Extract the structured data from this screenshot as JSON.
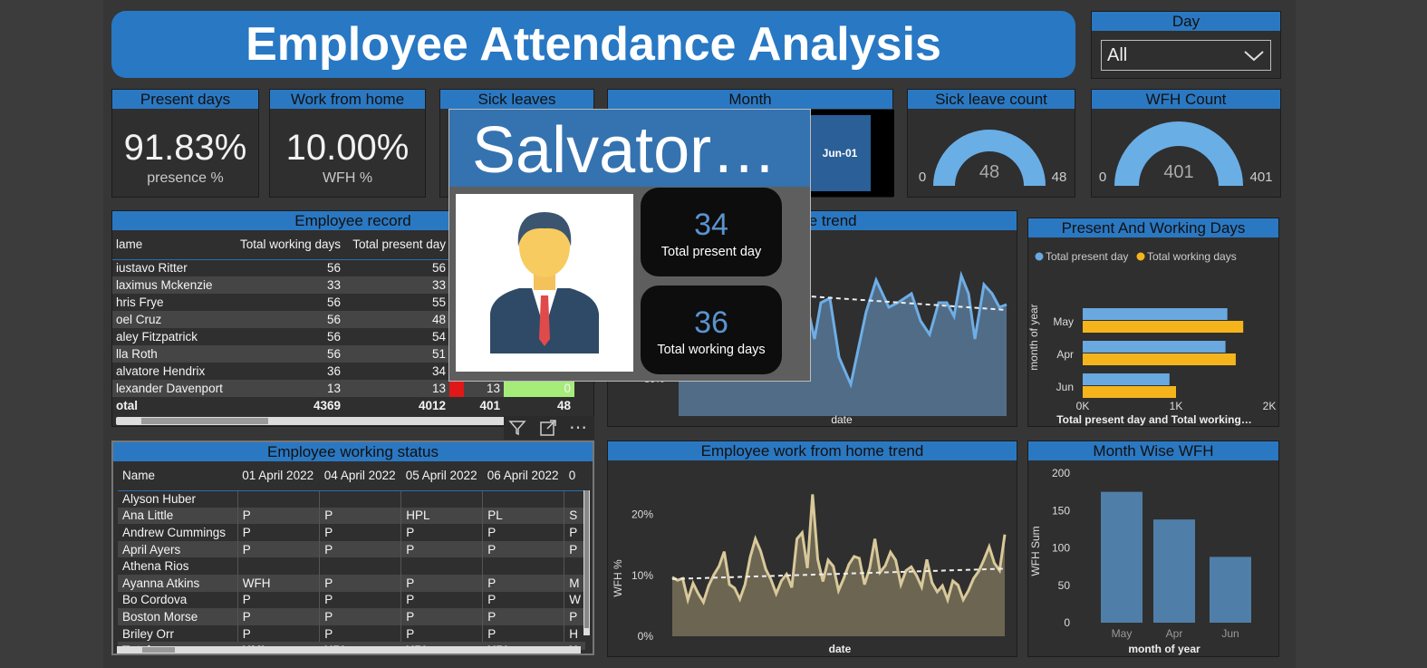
{
  "title": "Employee Attendance Analysis",
  "day_slicer": {
    "header": "Day",
    "value": "All"
  },
  "kpis": {
    "present": {
      "header": "Present days",
      "value": "91.83%",
      "label": "presence %"
    },
    "wfh": {
      "header": "Work from home",
      "value": "10.00%",
      "label": "WFH %"
    },
    "sick": {
      "header": "Sick leaves"
    },
    "month": {
      "header": "Month",
      "item": "Jun-01"
    }
  },
  "gauges": {
    "sick_count": {
      "header": "Sick leave count",
      "value": "48",
      "min": "0",
      "max": "48",
      "fill": 1.0
    },
    "wfh_count": {
      "header": "WFH Count",
      "value": "401",
      "min": "0",
      "max": "401",
      "fill": 1.0
    }
  },
  "employee_record": {
    "header": "Employee record",
    "columns": [
      "lame",
      "Total working days",
      "Total present day"
    ],
    "rows": [
      [
        "iustavo Ritter",
        "56",
        "56"
      ],
      [
        "laximus Mckenzie",
        "33",
        "33"
      ],
      [
        "hris Frye",
        "56",
        "55"
      ],
      [
        "oel Cruz",
        "56",
        "48"
      ],
      [
        "aley Fitzpatrick",
        "56",
        "54"
      ],
      [
        "lla Roth",
        "56",
        "51"
      ],
      [
        "alvatore Hendrix",
        "36",
        "34"
      ],
      [
        "lexander Davenport",
        "13",
        "13"
      ]
    ],
    "extra_row": {
      "c4": "13",
      "c5": "0"
    },
    "total": [
      "otal",
      "4369",
      "4012",
      "401",
      "48"
    ]
  },
  "tooltip": {
    "name": "Salvator…",
    "present_value": "34",
    "present_label": "Total present day",
    "working_value": "36",
    "working_label": "Total working days"
  },
  "presence_trend": {
    "header": "Employee presence trend",
    "header_visible": "esence trend",
    "x_label": "date",
    "y_tick": "80%"
  },
  "present_working": {
    "header": "Present And Working Days",
    "legend": [
      "Total present day",
      "Total working days"
    ],
    "colors": {
      "present": "#6aa8e0",
      "working": "#f5b41c"
    },
    "chart_data": {
      "type": "bar",
      "orientation": "horizontal",
      "categories": [
        "May",
        "Apr",
        "Jun"
      ],
      "series": [
        {
          "name": "Total present day",
          "values": [
            1550,
            1530,
            930
          ]
        },
        {
          "name": "Total working days",
          "values": [
            1720,
            1640,
            1000
          ]
        }
      ],
      "xlim": [
        0,
        2000
      ],
      "x_ticks": [
        "0K",
        "1K",
        "2K"
      ],
      "xlabel": "Total present day and Total working…",
      "ylabel": "month of year"
    }
  },
  "working_status": {
    "header": "Employee working status",
    "columns": [
      "Name",
      "01 April 2022",
      "04 April 2022",
      "05 April 2022",
      "06 April 2022",
      "0"
    ],
    "rows": [
      [
        "Alyson Huber",
        "",
        "",
        "",
        "",
        ""
      ],
      [
        "Ana Little",
        "P",
        "P",
        "HPL",
        "PL",
        "S"
      ],
      [
        "Andrew Cummings",
        "P",
        "P",
        "P",
        "P",
        "P"
      ],
      [
        "April Ayers",
        "P",
        "P",
        "P",
        "P",
        "P"
      ],
      [
        "Athena Rios",
        "",
        "",
        "",
        "",
        ""
      ],
      [
        "Ayanna Atkins",
        "WFH",
        "P",
        "P",
        "P",
        "M"
      ],
      [
        "Bo Cordova",
        "P",
        "P",
        "P",
        "P",
        "W"
      ],
      [
        "Boston Morse",
        "P",
        "P",
        "P",
        "P",
        "P"
      ],
      [
        "Briley Orr",
        "P",
        "P",
        "P",
        "P",
        "H"
      ]
    ],
    "total": [
      "Total",
      "HML",
      "HPL",
      "HPL",
      "HPL",
      "H"
    ]
  },
  "wfh_trend": {
    "header": "Employee work from home trend",
    "x_label": "date",
    "y_label": "WFH %",
    "y_ticks": [
      "20%",
      "10%",
      "0%"
    ],
    "chart_data": {
      "type": "area",
      "y_axis": "WFH %",
      "ylim": [
        0,
        0.25
      ],
      "values": [
        0.097,
        0.092,
        0.095,
        0.06,
        0.087,
        0.07,
        0.056,
        0.083,
        0.101,
        0.115,
        0.139,
        0.085,
        0.079,
        0.061,
        0.085,
        0.13,
        0.16,
        0.14,
        0.11,
        0.093,
        0.07,
        0.091,
        0.102,
        0.08,
        0.16,
        0.17,
        0.112,
        0.233,
        0.126,
        0.09,
        0.125,
        0.115,
        0.075,
        0.095,
        0.118,
        0.131,
        0.128,
        0.085,
        0.112,
        0.16,
        0.105,
        0.116,
        0.138,
        0.125,
        0.085,
        0.108,
        0.114,
        0.1,
        0.081,
        0.126,
        0.088,
        0.073,
        0.083,
        0.06,
        0.091,
        0.084,
        0.06,
        0.075,
        0.095,
        0.107,
        0.126,
        0.147,
        0.12,
        0.108,
        0.167
      ],
      "trend": [
        0.094,
        0.111
      ],
      "xlabel": "date",
      "ylabel": "WFH %"
    }
  },
  "month_wfh": {
    "header": "Month Wise WFH",
    "chart_data": {
      "type": "bar",
      "categories": [
        "May",
        "Apr",
        "Jun"
      ],
      "values": [
        175,
        138,
        88
      ],
      "ylim": [
        0,
        200
      ],
      "y_ticks": [
        "200",
        "150",
        "100",
        "50",
        "0"
      ],
      "xlabel": "month of year",
      "ylabel": "WFH Sum"
    }
  }
}
